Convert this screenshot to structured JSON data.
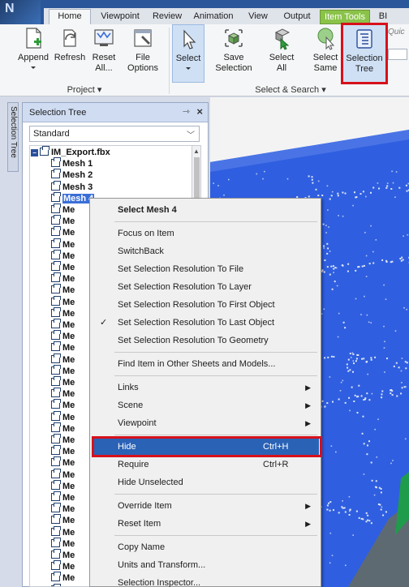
{
  "app": {
    "logo_text": "N"
  },
  "tabs": [
    {
      "label": "Home",
      "active": true
    },
    {
      "label": "Viewpoint"
    },
    {
      "label": "Review"
    },
    {
      "label": "Animation"
    },
    {
      "label": "View"
    },
    {
      "label": "Output"
    },
    {
      "label": "Item Tools",
      "contextual": true
    },
    {
      "label": "BI"
    }
  ],
  "ribbon": {
    "project_group": {
      "label": "Project",
      "buttons": [
        {
          "label": "Append"
        },
        {
          "label": "Refresh"
        },
        {
          "label": "Reset\nAll..."
        },
        {
          "label": "File\nOptions"
        }
      ]
    },
    "select_group": {
      "label": "Select & Search",
      "buttons": [
        {
          "label": "Select"
        },
        {
          "label": "Save\nSelection"
        },
        {
          "label": "Select\nAll"
        },
        {
          "label": "Select\nSame"
        },
        {
          "label": "Selection\nTree"
        }
      ]
    },
    "quick_stub": "Quic"
  },
  "side_tab": {
    "label": "Selection Tree"
  },
  "panel": {
    "title": "Selection Tree",
    "dropdown_value": "Standard",
    "tree": {
      "root": "IM_Export.fbx",
      "items": [
        "Mesh 1",
        "Mesh 2",
        "Mesh 3",
        "Mesh 4"
      ],
      "truncated_label": "Me",
      "selected_index": 3
    }
  },
  "context_menu": {
    "items": [
      {
        "label": "Select Mesh 4",
        "bold": true
      },
      {
        "sep": true
      },
      {
        "label": "Focus on Item"
      },
      {
        "label": "SwitchBack"
      },
      {
        "label": "Set Selection Resolution To File"
      },
      {
        "label": "Set Selection Resolution To Layer"
      },
      {
        "label": "Set Selection Resolution To First Object"
      },
      {
        "label": "Set Selection Resolution To Last Object",
        "checked": true
      },
      {
        "label": "Set Selection Resolution To Geometry"
      },
      {
        "sep": true
      },
      {
        "label": "Find Item in Other Sheets and Models..."
      },
      {
        "sep": true
      },
      {
        "label": "Links",
        "submenu": true
      },
      {
        "label": "Scene",
        "submenu": true
      },
      {
        "label": "Viewpoint",
        "submenu": true
      },
      {
        "sep": true
      },
      {
        "label": "Hide",
        "shortcut": "Ctrl+H",
        "highlighted": true
      },
      {
        "label": "Require",
        "shortcut": "Ctrl+R"
      },
      {
        "label": "Hide Unselected"
      },
      {
        "sep": true
      },
      {
        "label": "Override Item",
        "submenu": true
      },
      {
        "label": "Reset Item",
        "submenu": true
      },
      {
        "sep": true
      },
      {
        "label": "Copy Name"
      },
      {
        "label": "Units and Transform..."
      },
      {
        "label": "Selection Inspector..."
      }
    ]
  },
  "colors": {
    "accent_blue": "#2a62b6",
    "highlight_red": "#d7111b",
    "contextual_tab": "#8bc34a",
    "viewport_blue": "#2f5fe0"
  }
}
